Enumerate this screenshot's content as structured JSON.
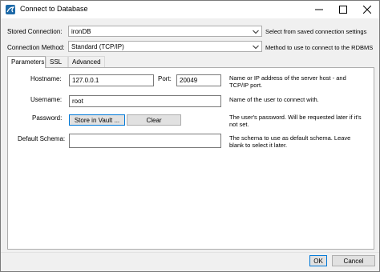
{
  "window": {
    "title": "Connect to Database",
    "icons": {
      "app": "mysql-workbench-icon",
      "minimize": "minimize-icon",
      "maximize": "maximize-icon",
      "close": "close-icon"
    }
  },
  "stored_connection": {
    "label": "Stored Connection:",
    "value": "ironDB",
    "help": "Select from saved connection settings"
  },
  "connection_method": {
    "label": "Connection Method:",
    "value": "Standard (TCP/IP)",
    "help": "Method to use to connect to the RDBMS"
  },
  "tabs": [
    {
      "label": "Parameters",
      "active": true
    },
    {
      "label": "SSL",
      "active": false
    },
    {
      "label": "Advanced",
      "active": false
    }
  ],
  "params": {
    "hostname": {
      "label": "Hostname:",
      "value": "127.0.0.1"
    },
    "port": {
      "label": "Port:",
      "value": "20049"
    },
    "host_help_1": "Name or IP address of the server host - and",
    "host_help_2": "TCP/IP port.",
    "username": {
      "label": "Username:",
      "value": "root",
      "help": "Name of the user to connect with."
    },
    "password": {
      "label": "Password:",
      "store_button": "Store in Vault ...",
      "clear_button": "Clear",
      "help_1": "The user's password. Will be requested later if it's",
      "help_2": "not set."
    },
    "schema": {
      "label": "Default Schema:",
      "value": "",
      "help_1": "The schema to use as default schema. Leave",
      "help_2": "blank to select it later."
    }
  },
  "footer": {
    "ok": "OK",
    "cancel": "Cancel"
  }
}
